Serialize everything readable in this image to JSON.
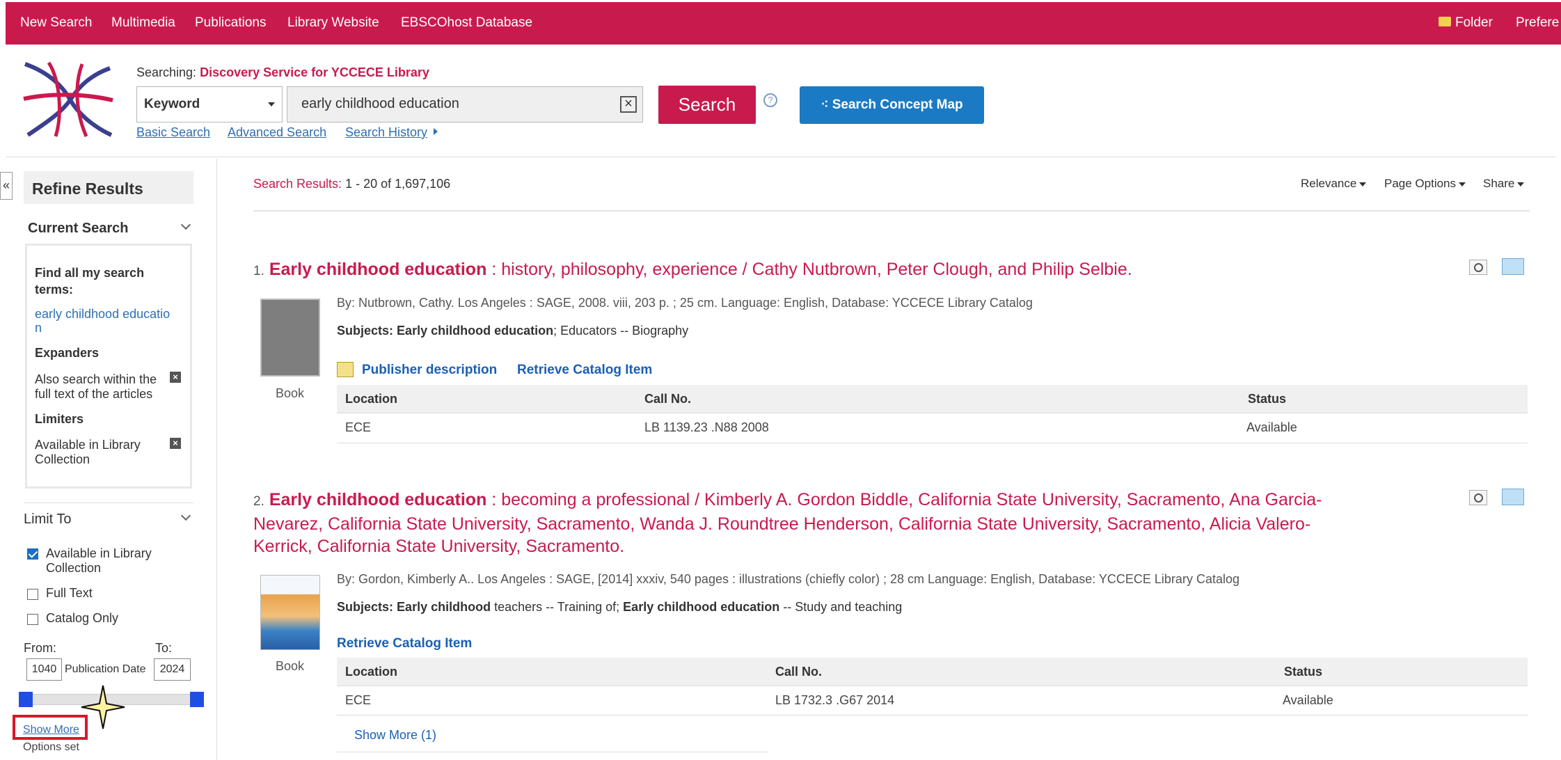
{
  "topnav": {
    "items": [
      "New Search",
      "Multimedia",
      "Publications",
      "Library Website",
      "EBSCOhost Database"
    ],
    "folder": "Folder",
    "preferences": "Prefere"
  },
  "header": {
    "searching_label": "Searching:",
    "searching_db": "Discovery Service for YCCECE Library",
    "field_select": "Keyword",
    "query": "early childhood education",
    "search_button": "Search",
    "help": "?",
    "concept_map_button": "Search Concept Map",
    "links": [
      "Basic Search",
      "Advanced Search",
      "Search History"
    ]
  },
  "sidebar": {
    "collapse": "«",
    "refine_title": "Refine Results",
    "current_search": "Current Search",
    "find_all_label": "Find all my search terms:",
    "find_all_value_1": "early childhood educatio",
    "find_all_value_2": "n",
    "expanders_label": "Expanders",
    "expander_text_1": "Also search within the",
    "expander_text_2": "full text of the articles",
    "limiters_label": "Limiters",
    "limiter_text_1": "Available in Library",
    "limiter_text_2": "Collection",
    "limit_to": "Limit To",
    "checkboxes": [
      {
        "label1": "Available in Library",
        "label2": "Collection",
        "checked": true
      },
      {
        "label1": "Full Text",
        "label2": "",
        "checked": false
      },
      {
        "label1": "Catalog Only",
        "label2": "",
        "checked": false
      }
    ],
    "from_label": "From:",
    "to_label": "To:",
    "from_value": "1040",
    "to_value": "2024",
    "pub_date_label": "Publication Date",
    "show_more": "Show More",
    "options_set": "Options set"
  },
  "results": {
    "count_label": "Search Results:",
    "count_value": "1 - 20 of 1,697,106",
    "sort": "Relevance",
    "page_options": "Page Options",
    "share": "Share",
    "items": [
      {
        "num": "1.",
        "title_bold": "Early childhood education",
        "title_rest": " : history, philosophy, experience / Cathy Nutbrown, Peter Clough, and Philip Selbie.",
        "meta": "By: Nutbrown, Cathy. Los Angeles : SAGE, 2008. viii, 203 p. ; 25 cm. Language: English, Database: YCCECE Library Catalog",
        "subjects_label": "Subjects:",
        "subjects_bold": "Early childhood education",
        "subjects_rest": "; Educators -- Biography",
        "action_1": "Publisher description",
        "action_2": "Retrieve Catalog Item",
        "type": "Book",
        "table_headers": [
          "Location",
          "Call No.",
          "Status"
        ],
        "row": [
          "ECE",
          "LB 1139.23 .N88 2008",
          "Available"
        ]
      },
      {
        "num": "2.",
        "title_bold": "Early childhood education",
        "title_line1": " : becoming a professional / Kimberly A. Gordon Biddle, California State University, Sacramento, Ana Garcia-",
        "title_line2": "Nevarez, California State University, Sacramento, Wanda J. Roundtree Henderson, California State University, Sacramento, Alicia Valero-",
        "title_line3": "Kerrick, California State University, Sacramento.",
        "meta": "By: Gordon, Kimberly A.. Los Angeles : SAGE, [2014] xxxiv, 540 pages : illustrations (chiefly color) ; 28 cm Language: English, Database: YCCECE Library Catalog",
        "subjects_label": "Subjects:",
        "subjects_bold1": "Early childhood",
        "subjects_mid": " teachers -- Training of; ",
        "subjects_bold2": "Early childhood education",
        "subjects_rest": " -- Study and teaching",
        "action_1": "Retrieve Catalog Item",
        "type": "Book",
        "table_headers": [
          "Location",
          "Call No.",
          "Status"
        ],
        "row": [
          "ECE",
          "LB 1732.3 .G67 2014",
          "Available"
        ],
        "show_more": "Show More (1)"
      }
    ]
  },
  "colors": {
    "brand": "#c91a4e",
    "link": "#2f6fb2",
    "concept_button": "#1a7ac4",
    "highlight_box": "#d8182c"
  }
}
